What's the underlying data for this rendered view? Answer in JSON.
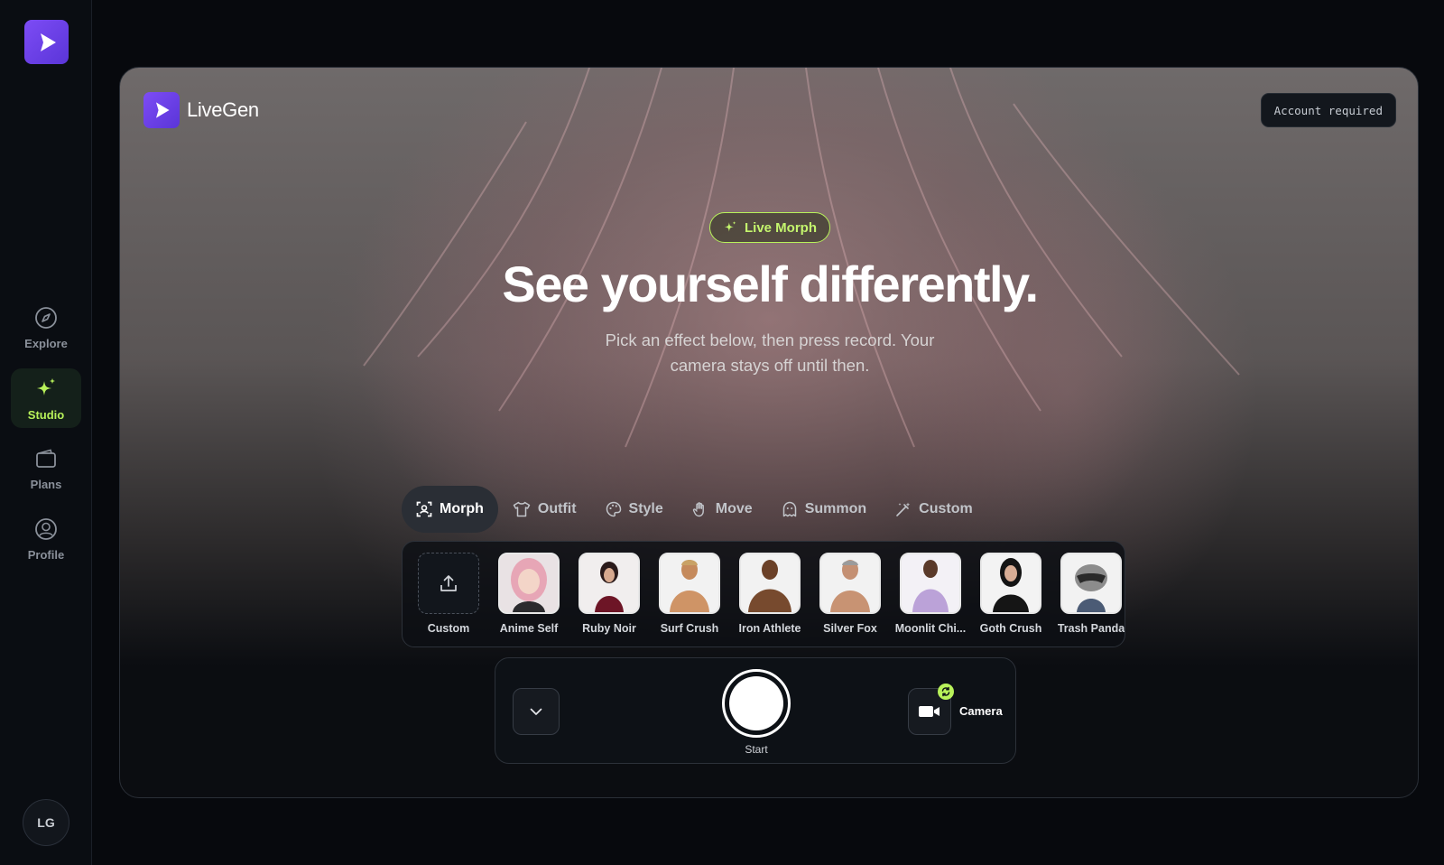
{
  "sidebar": {
    "nav": [
      {
        "label": "Explore",
        "icon": "compass-icon"
      },
      {
        "label": "Studio",
        "icon": "sparkle-icon",
        "active": true
      },
      {
        "label": "Plans",
        "icon": "wallet-icon"
      },
      {
        "label": "Profile",
        "icon": "user-circle-icon"
      }
    ],
    "avatar_initials": "LG"
  },
  "header": {
    "brand_name": "LiveGen",
    "account_status": "Account required"
  },
  "hero": {
    "badge": "Live Morph",
    "title": "See yourself differently.",
    "subtitle": "Pick an effect below, then press record. Your camera stays off until then."
  },
  "tabs": [
    {
      "label": "Morph",
      "icon": "morph-icon",
      "active": true
    },
    {
      "label": "Outfit",
      "icon": "shirt-icon"
    },
    {
      "label": "Style",
      "icon": "palette-icon"
    },
    {
      "label": "Move",
      "icon": "hand-icon"
    },
    {
      "label": "Summon",
      "icon": "ghost-icon"
    },
    {
      "label": "Custom",
      "icon": "wand-icon"
    }
  ],
  "effects": [
    {
      "label": "Custom",
      "type": "upload"
    },
    {
      "label": "Anime Self"
    },
    {
      "label": "Ruby Noir"
    },
    {
      "label": "Surf Crush"
    },
    {
      "label": "Iron Athlete"
    },
    {
      "label": "Silver Fox"
    },
    {
      "label": "Moonlit Chi..."
    },
    {
      "label": "Goth Crush"
    },
    {
      "label": "Trash Panda"
    }
  ],
  "controls": {
    "record_label": "Start",
    "camera_label": "Camera"
  },
  "colors": {
    "accent": "#b8f25a",
    "brand": "#6a3ee6",
    "background": "#07090d"
  }
}
